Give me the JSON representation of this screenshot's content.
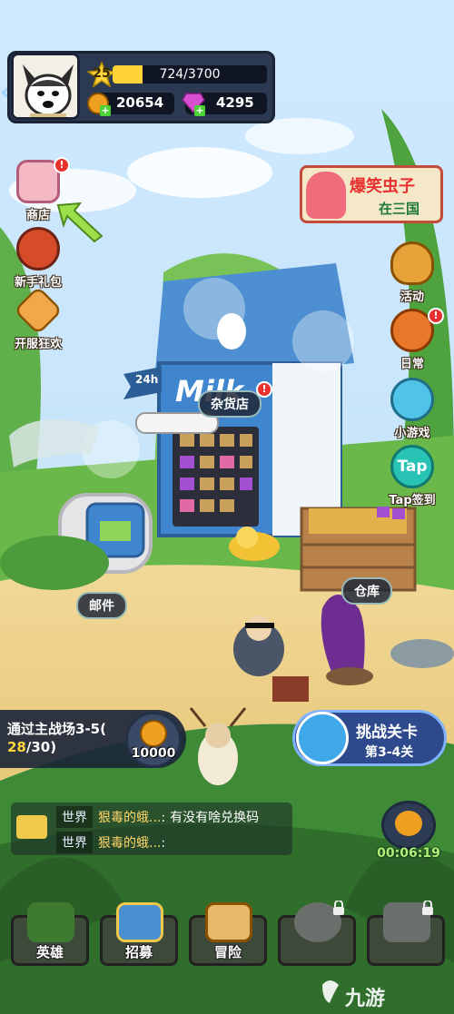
{
  "player": {
    "level": "25",
    "exp_text": "724/3700",
    "exp_fraction": 0.196,
    "gold": "20654",
    "gems": "4295"
  },
  "left_menu": [
    {
      "label": "商店",
      "icon": "shop-icon"
    },
    {
      "label": "新手礼包",
      "icon": "gift-pack-icon"
    },
    {
      "label": "开服狂欢",
      "icon": "celebration-icon"
    }
  ],
  "right_menu": [
    {
      "label": "活动",
      "icon": "activity-pot-icon"
    },
    {
      "label": "日常",
      "icon": "daily-leaf-icon"
    },
    {
      "label": "小游戏",
      "icon": "gamepad-icon"
    },
    {
      "label": "Tap签到",
      "icon": "tap-checkin-icon",
      "glyph": "Tap"
    }
  ],
  "banner": {
    "line1": "爆笑虫子",
    "line2": "在三国"
  },
  "buildings": {
    "store_label": "杂货店",
    "carton_text": "Milk",
    "sign_text": "24h",
    "mail_label": "邮件",
    "warehouse_label": "仓库"
  },
  "quest": {
    "title": "通过主战场3-5(",
    "progress_current": "28",
    "progress_total": "/30)",
    "reward": "10000"
  },
  "challenge": {
    "title": "挑战关卡",
    "stage": "第3-4关"
  },
  "chat": [
    {
      "channel": "世界",
      "name": "狠毒的蛾...",
      "message": "有没有啥兑换码"
    },
    {
      "channel": "世界",
      "name": "狠毒的蛾...",
      "message": ""
    }
  ],
  "timer": "00:06:19",
  "nav": [
    {
      "label": "英雄",
      "icon": "hero-bug-icon",
      "locked": false
    },
    {
      "label": "招募",
      "icon": "recruit-cards-icon",
      "locked": false
    },
    {
      "label": "冒险",
      "icon": "adventure-map-icon",
      "locked": false
    },
    {
      "label": "",
      "icon": "locked-slot-icon",
      "locked": true
    },
    {
      "label": "",
      "icon": "locked-slot-icon",
      "locked": true
    }
  ],
  "watermark": "九游",
  "colors": {
    "gold": "#ffd43b",
    "gem": "#d94fd1",
    "accent_blue": "#2e4a8c",
    "red_dot": "#e8302f"
  }
}
